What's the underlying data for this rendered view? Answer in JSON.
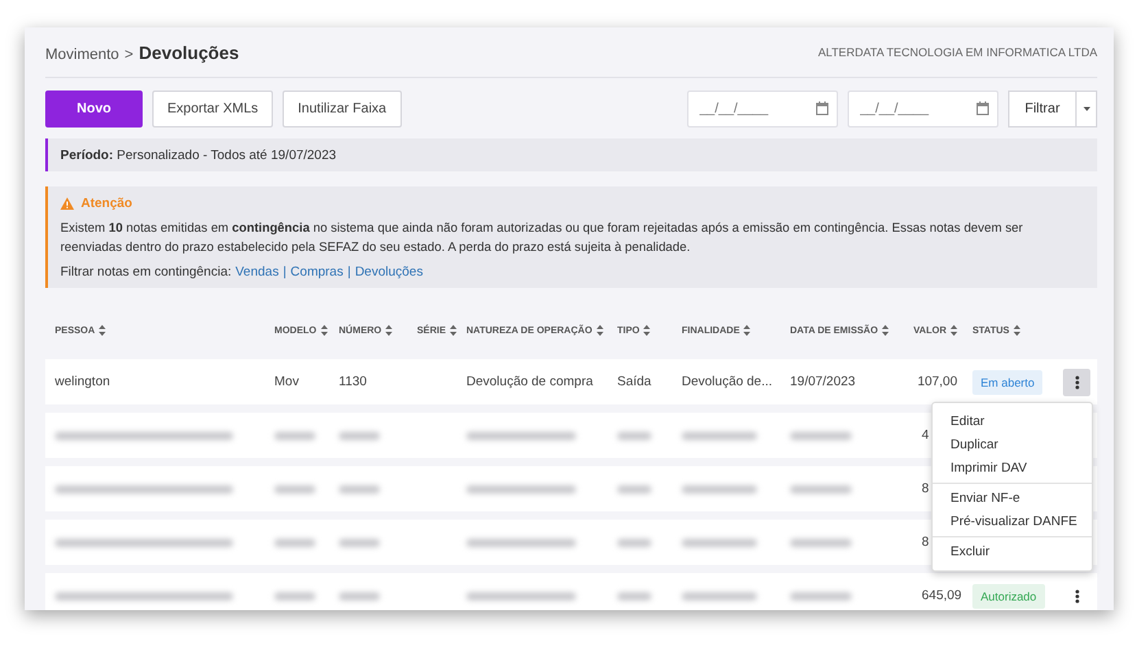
{
  "breadcrumb": {
    "parent": "Movimento",
    "separator": ">",
    "current": "Devoluções"
  },
  "company": "ALTERDATA TECNOLOGIA EM INFORMATICA LTDA",
  "toolbar": {
    "buttons": [
      {
        "label": "Novo",
        "kind": "primary"
      },
      {
        "label": "Exportar XMLs",
        "kind": "secondary"
      },
      {
        "label": "Inutilizar Faixa",
        "kind": "secondary"
      }
    ],
    "date_fields": [
      {
        "placeholder": "__/__/____"
      },
      {
        "placeholder": "__/__/____"
      }
    ],
    "filter_button": "Filtrar"
  },
  "period": {
    "label": "Período:",
    "value": "Personalizado - Todos até 19/07/2023"
  },
  "alert": {
    "title": "Atenção",
    "message": "Existem **10** notas emitidas em **contingência** no sistema que ainda não foram autorizadas ou que foram rejeitadas após a emissão em contingência. Essas notas devem ser reenviadas dentro do prazo estabelecido pela SEFAZ do seu estado. A perda do prazo está sujeita à penalidade.",
    "filter_label": "Filtrar notas em contingência:",
    "links": [
      "Vendas",
      "Compras",
      "Devoluções"
    ],
    "link_separator": "|"
  },
  "table": {
    "columns": [
      "PESSOA",
      "MODELO",
      "NÚMERO",
      "SÉRIE",
      "NATUREZA DE OPERAÇÃO",
      "TIPO",
      "FINALIDADE",
      "DATA DE EMISSÃO",
      "VALOR",
      "STATUS"
    ],
    "rows": [
      {
        "kind": "plain",
        "cells": [
          "welington",
          "Mov",
          "1130",
          "",
          "Devolução de compra",
          "Saída",
          "Devolução de...",
          "19/07/2023",
          "107,00"
        ],
        "status": "Em aberto",
        "color": "#2f84d6",
        "menu_open": true
      },
      {
        "kind": "blurred",
        "valor": "4"
      },
      {
        "kind": "blurred",
        "valor": "8"
      },
      {
        "kind": "blurred",
        "valor": "8"
      },
      {
        "kind": "blurred",
        "valor": "645,09",
        "status": "Autorizado",
        "color": "#34a853"
      }
    ]
  },
  "menu": {
    "groups": [
      [
        "Editar",
        "Duplicar",
        "Imprimir DAV"
      ],
      [
        "Enviar NF-e",
        "Pré-visualizar DANFE"
      ],
      [
        "Excluir"
      ]
    ]
  }
}
